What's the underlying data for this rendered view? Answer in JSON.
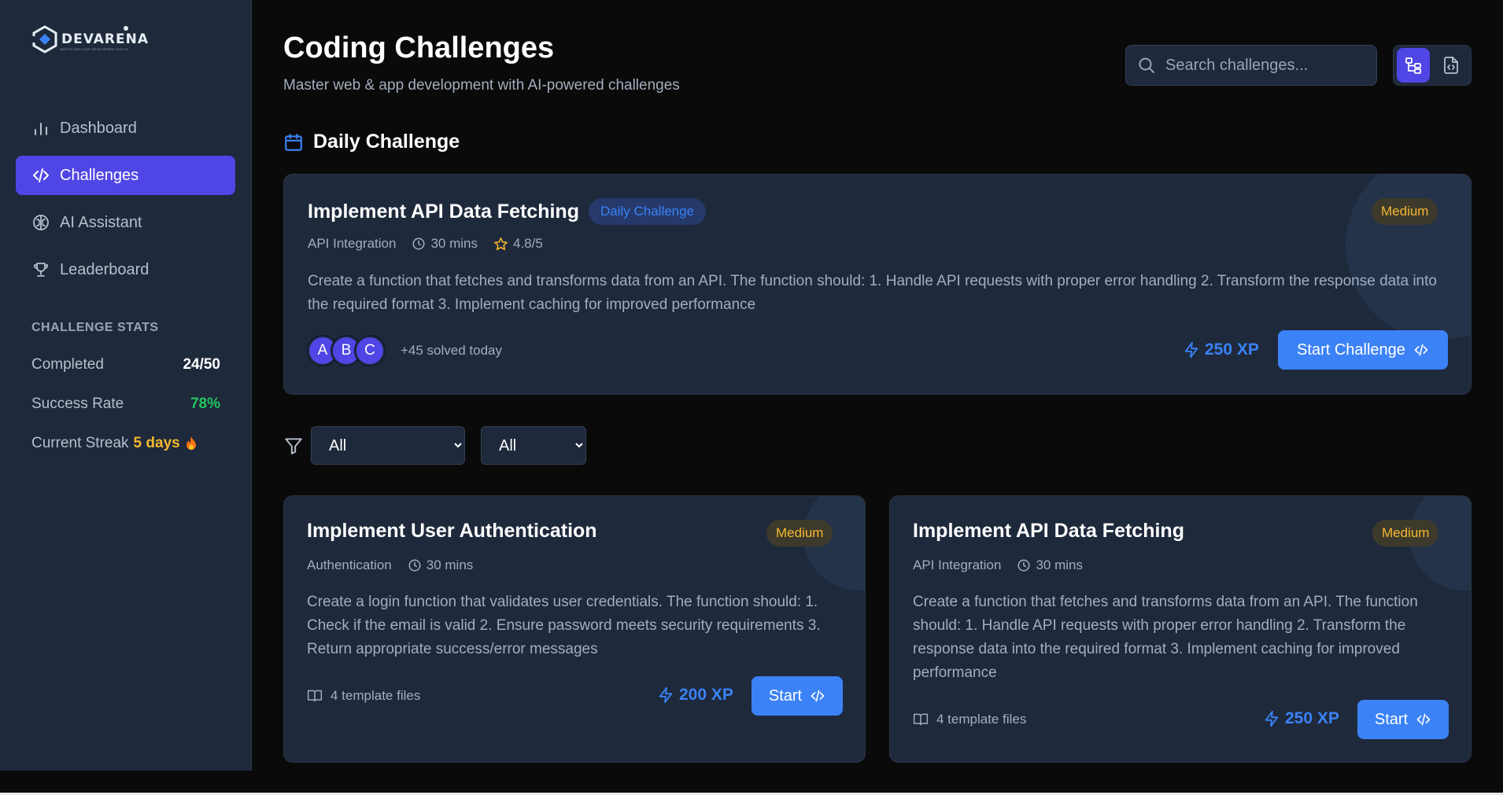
{
  "app": {
    "logo_text": "DEVARENA",
    "logo_tagline": "MASTER WEB & APP DEVELOPMENT WITH AI"
  },
  "sidebar": {
    "items": [
      {
        "label": "Dashboard",
        "icon": "bar-chart-icon",
        "active": false
      },
      {
        "label": "Challenges",
        "icon": "code-icon",
        "active": true
      },
      {
        "label": "AI Assistant",
        "icon": "brain-icon",
        "active": false
      },
      {
        "label": "Leaderboard",
        "icon": "trophy-icon",
        "active": false
      }
    ],
    "stats_title": "CHALLENGE STATS",
    "stats": [
      {
        "label": "Completed",
        "value": "24/50"
      },
      {
        "label": "Success Rate",
        "value": "78%"
      },
      {
        "label": "Current Streak",
        "value": "5 days"
      }
    ]
  },
  "header": {
    "title": "Coding Challenges",
    "subtitle": "Master web & app development with AI-powered challenges",
    "search_placeholder": "Search challenges..."
  },
  "daily": {
    "section_title": "Daily Challenge",
    "title": "Implement API Data Fetching",
    "badge": "Daily Challenge",
    "difficulty": "Medium",
    "category": "API Integration",
    "duration": "30 mins",
    "rating": "4.8/5",
    "description": "Create a function that fetches and transforms data from an API. The function should: 1. Handle API requests with proper error handling 2. Transform the response data into the required format 3. Implement caching for improved performance",
    "avatars": [
      "A",
      "B",
      "C"
    ],
    "solved_text": "+45 solved today",
    "xp": "250 XP",
    "button": "Start Challenge"
  },
  "filters": {
    "filter1": {
      "selected": "All",
      "options": [
        "All"
      ]
    },
    "filter2": {
      "selected": "All",
      "options": [
        "All"
      ]
    }
  },
  "challenges": [
    {
      "title": "Implement User Authentication",
      "difficulty": "Medium",
      "category": "Authentication",
      "duration": "30 mins",
      "description": "Create a login function that validates user credentials. The function should: 1. Check if the email is valid 2. Ensure password meets security requirements 3. Return appropriate success/error messages",
      "files": "4 template files",
      "xp": "200 XP",
      "button": "Start"
    },
    {
      "title": "Implement API Data Fetching",
      "difficulty": "Medium",
      "category": "API Integration",
      "duration": "30 mins",
      "description": "Create a function that fetches and transforms data from an API. The function should: 1. Handle API requests with proper error handling 2. Transform the response data into the required format 3. Implement caching for improved performance",
      "files": "4 template files",
      "xp": "250 XP",
      "button": "Start"
    }
  ],
  "colors": {
    "accent": "#5046e5",
    "primary_button": "#3b82f6",
    "medium_text": "#f5b82e",
    "success": "#22c55e",
    "sidebar_bg": "#1e293b",
    "page_bg": "#0a0a0a"
  }
}
